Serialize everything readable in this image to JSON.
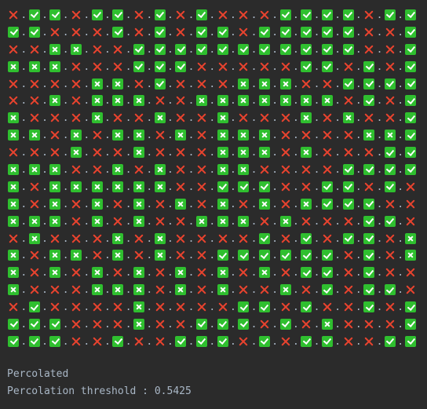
{
  "legend": {
    "X": "closed site (red cross)",
    "C": "full open site (green check)",
    "B": "open site (green boxed cross)"
  },
  "colors": {
    "background": "#2b2b2b",
    "text": "#a9b7c6",
    "closed": "#e8432e",
    "open": "#2fbf2f",
    "glyph": "#ffffff"
  },
  "grid": {
    "rows": [
      "XCCXCCXCXCXXXCCCCXCC",
      "CCXXXCXCXCCXCCCCCXXC",
      "XXBBXXCCCCCCCCCCCXXC",
      "BBBXXXCCCXXXXXCCXCXC",
      "XXXXBBXCXXXBBBXXCCCC",
      "XXBXBBBXXBBBBBBBXCXC",
      "BXXXBXXBXXBXXXBXBXXC",
      "BBXBXBBXBXBBBXXXXBBC",
      "XXXBXXBXXXBBBXBXXXCC",
      "BBBXXBXBXXBBXXXXCCCC",
      "BXBBBBBBXXCCCXXCCXCX",
      "BXBXBXBXBXBXBXBCCCXX",
      "BBBXBXBXXBBBXBXXXCCX",
      "XBXXXBXBXXXXCXCXCCXB",
      "BXBBXBXBXXCCCCCCXCXB",
      "BXBXBXBXBXBXBXCCXCXX",
      "BXXXBBBXBXBXXBXCXCCX",
      "XCXXXXBXXXXCCXCXXCXC",
      "CCCXXXBXXCCCXCXBXXXC",
      "CCCXXCXXCCCXCXCCXXCC"
    ]
  },
  "output": {
    "status": "Percolated",
    "threshold_line": "Percolation threshold : 0.5425"
  }
}
